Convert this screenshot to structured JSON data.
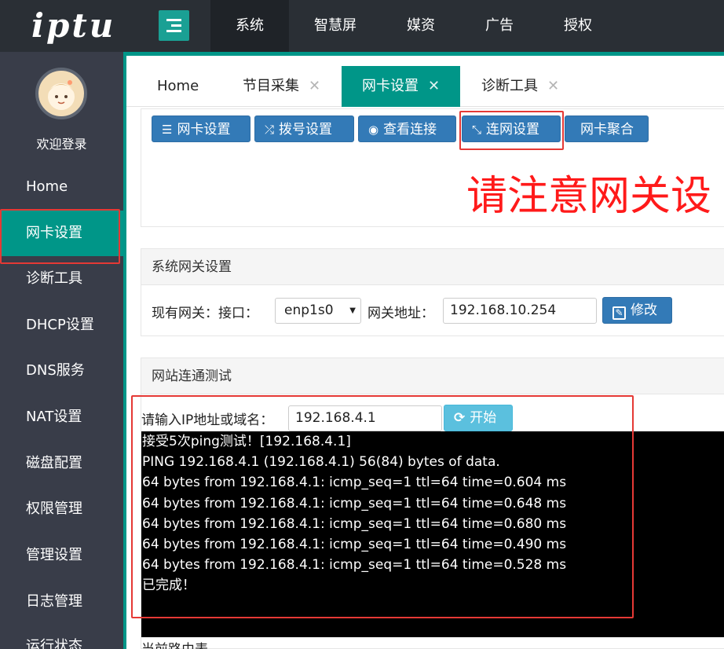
{
  "app": {
    "logo": "iptu",
    "top_nav": [
      "系统",
      "智慧屏",
      "媒资",
      "广告",
      "授权"
    ],
    "active_top_nav": 0
  },
  "sidebar": {
    "welcome": "欢迎登录",
    "items": [
      "Home",
      "网卡设置",
      "诊断工具",
      "DHCP设置",
      "DNS服务",
      "NAT设置",
      "磁盘配置",
      "权限管理",
      "管理设置",
      "日志管理",
      "运行状态"
    ],
    "active_index": 1
  },
  "tabs": [
    {
      "label": "Home",
      "closable": false
    },
    {
      "label": "节目采集",
      "closable": true
    },
    {
      "label": "网卡设置",
      "closable": true,
      "active": true
    },
    {
      "label": "诊断工具",
      "closable": true
    }
  ],
  "toolbar": {
    "buttons": [
      {
        "label": "网卡设置",
        "icon": "list-icon"
      },
      {
        "label": "拨号设置",
        "icon": "shuffle-icon"
      },
      {
        "label": "查看连接",
        "icon": "eye-icon"
      },
      {
        "label": "连网设置",
        "icon": "compress-icon"
      },
      {
        "label": "网卡聚合",
        "icon": ""
      }
    ],
    "highlighted": "连网设置"
  },
  "warning_text": "请注意网关设",
  "gateway_panel": {
    "title": "系统网关设置",
    "interface_label": "现有网关：接口：",
    "interface_value": "enp1s0",
    "address_label": "网关地址：",
    "address_value": "192.168.10.254",
    "edit_button": "修改"
  },
  "ping_panel": {
    "title": "网站连通测试",
    "input_label": "请输入IP地址或域名：",
    "input_value": "192.168.4.1",
    "start_button": "开始",
    "output": [
      "接受5次ping测试！[192.168.4.1]",
      "PING 192.168.4.1 (192.168.4.1) 56(84) bytes of data.",
      "64 bytes from 192.168.4.1: icmp_seq=1 ttl=64 time=0.604 ms",
      "64 bytes from 192.168.4.1: icmp_seq=1 ttl=64 time=0.648 ms",
      "64 bytes from 192.168.4.1: icmp_seq=1 ttl=64 time=0.680 ms",
      "64 bytes from 192.168.4.1: icmp_seq=1 ttl=64 time=0.490 ms",
      "64 bytes from 192.168.4.1: icmp_seq=1 ttl=64 time=0.528 ms",
      "已完成！"
    ]
  },
  "footer_text": "当前路由表",
  "colors": {
    "topbar": "#2a2f35",
    "sidebar": "#393d49",
    "accent": "#009688",
    "primary_button": "#337ab7",
    "info_button": "#5bc0de",
    "warning": "#ff1a1a",
    "highlight_box": "#e53935"
  }
}
